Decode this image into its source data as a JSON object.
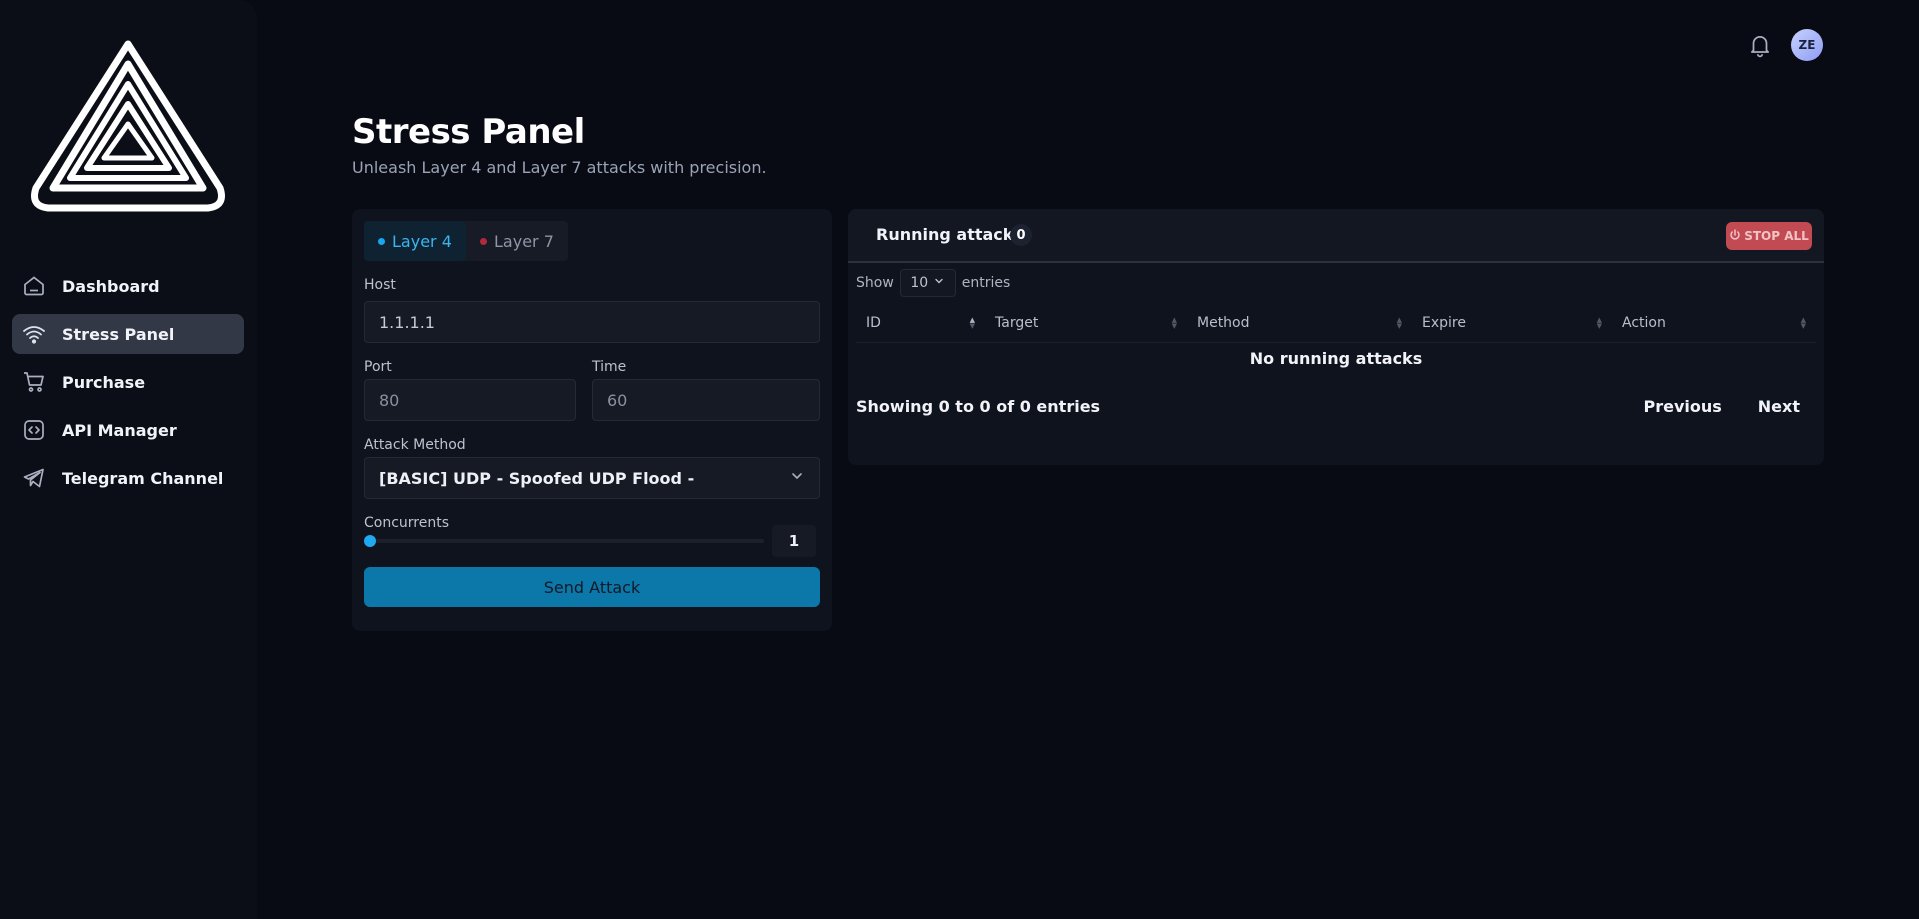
{
  "sidebar": {
    "logo": "triangle-logo",
    "items": [
      {
        "label": "Dashboard",
        "icon": "home-icon"
      },
      {
        "label": "Stress Panel",
        "icon": "wifi-icon"
      },
      {
        "label": "Purchase",
        "icon": "cart-icon"
      },
      {
        "label": "API Manager",
        "icon": "code-icon"
      },
      {
        "label": "Telegram Channel",
        "icon": "send-icon"
      }
    ],
    "active_index": 1
  },
  "header": {
    "notification_icon": "bell-icon",
    "avatar_initials": "ZE"
  },
  "page": {
    "title": "Stress Panel",
    "subtitle": "Unleash Layer 4 and Layer 7 attacks with precision."
  },
  "form": {
    "tabs": [
      {
        "label": "Layer 4",
        "dot_color": "#1aa6ee"
      },
      {
        "label": "Layer 7",
        "dot_color": "#b02a3a"
      }
    ],
    "active_tab": 0,
    "host_label": "Host",
    "host_value": "1.1.1.1",
    "port_label": "Port",
    "port_placeholder": "80",
    "time_label": "Time",
    "time_placeholder": "60",
    "method_label": "Attack Method",
    "method_value": "[BASIC] UDP - Spoofed UDP Flood -",
    "concurrents_label": "Concurrents",
    "concurrents_value": "1",
    "send_label": "Send Attack"
  },
  "attacks": {
    "title": "Running attacks",
    "count": "0",
    "stop_all_label": "STOP ALL",
    "show_label": "Show",
    "entries_label": "entries",
    "page_size": "10",
    "columns": [
      "ID",
      "Target",
      "Method",
      "Expire",
      "Action"
    ],
    "empty_message": "No running attacks",
    "info": "Showing 0 to 0 of 0 entries",
    "prev_label": "Previous",
    "next_label": "Next"
  },
  "colors": {
    "accent": "#1aa6ee",
    "danger": "#c24b53",
    "background": "#080b13"
  }
}
